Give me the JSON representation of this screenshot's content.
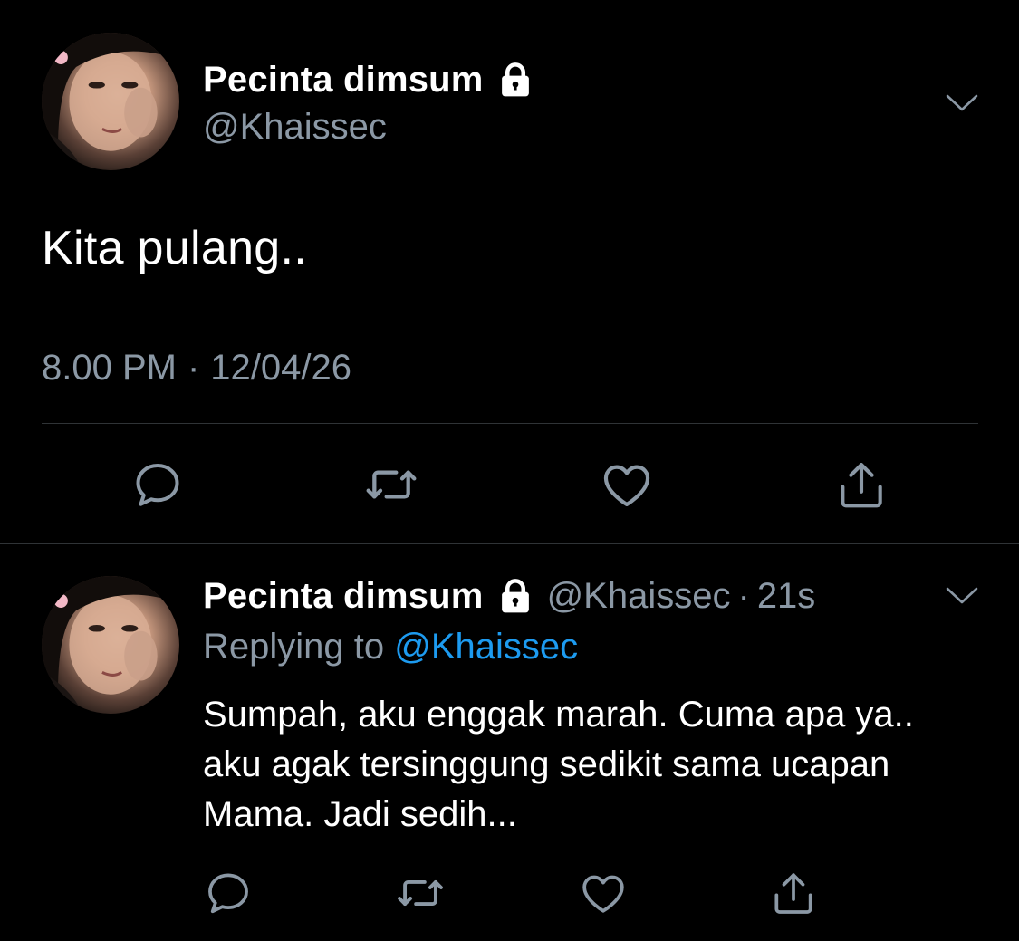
{
  "colors": {
    "background": "#000000",
    "text_primary": "#ffffff",
    "text_secondary": "#8b98a5",
    "link": "#1d9bf0",
    "divider": "#2f3336"
  },
  "main_tweet": {
    "display_name": "Pecinta dimsum",
    "handle": "@Khaissec",
    "protected_icon": "lock-icon",
    "menu_icon": "chevron-down-icon",
    "text": "Kita pulang..",
    "time": "8.00 PM",
    "separator": "·",
    "date": "12/04/26",
    "actions": {
      "reply_icon": "reply-icon",
      "retweet_icon": "retweet-icon",
      "like_icon": "heart-icon",
      "share_icon": "share-icon"
    }
  },
  "reply_tweet": {
    "display_name": "Pecinta dimsum",
    "handle": "@Khaissec",
    "separator": "·",
    "relative_time": "21s",
    "replying_to_prefix": "Replying to",
    "replying_to_handle": "@Khaissec",
    "text": "Sumpah, aku enggak marah. Cuma apa ya.. aku agak tersinggung sedikit sama ucapan Mama. Jadi sedih...",
    "protected_icon": "lock-icon",
    "menu_icon": "chevron-down-icon",
    "actions": {
      "reply_icon": "reply-icon",
      "retweet_icon": "retweet-icon",
      "like_icon": "heart-icon",
      "share_icon": "share-icon"
    }
  }
}
